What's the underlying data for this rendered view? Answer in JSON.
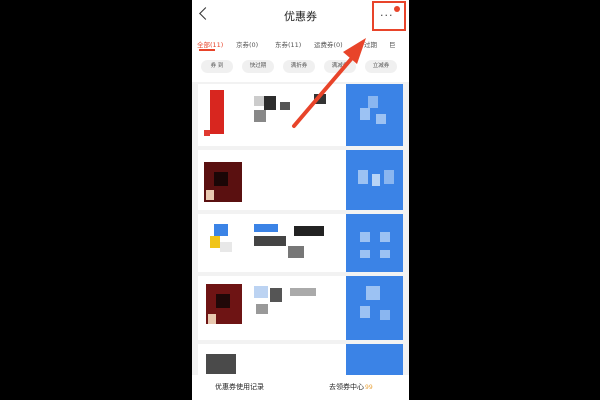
{
  "navbar": {
    "title": "优惠券",
    "more_dots": "···"
  },
  "tabs": [
    {
      "label": "全部(11)",
      "active": true
    },
    {
      "label": "京券(0)",
      "active": false
    },
    {
      "label": "东券(11)",
      "active": false
    },
    {
      "label": "运费券(0)",
      "active": false
    },
    {
      "label": "过期",
      "active": false
    },
    {
      "label": "巨",
      "active": false
    }
  ],
  "chips": [
    "券 到",
    "快过期",
    "满折券",
    "满减券",
    "立减券"
  ],
  "footer": {
    "history_label": "优惠券使用记录",
    "center_label": "去领券中心",
    "center_badge": "99"
  },
  "colors": {
    "accent": "#e8442a",
    "coupon_blue": "#3b83e6"
  }
}
